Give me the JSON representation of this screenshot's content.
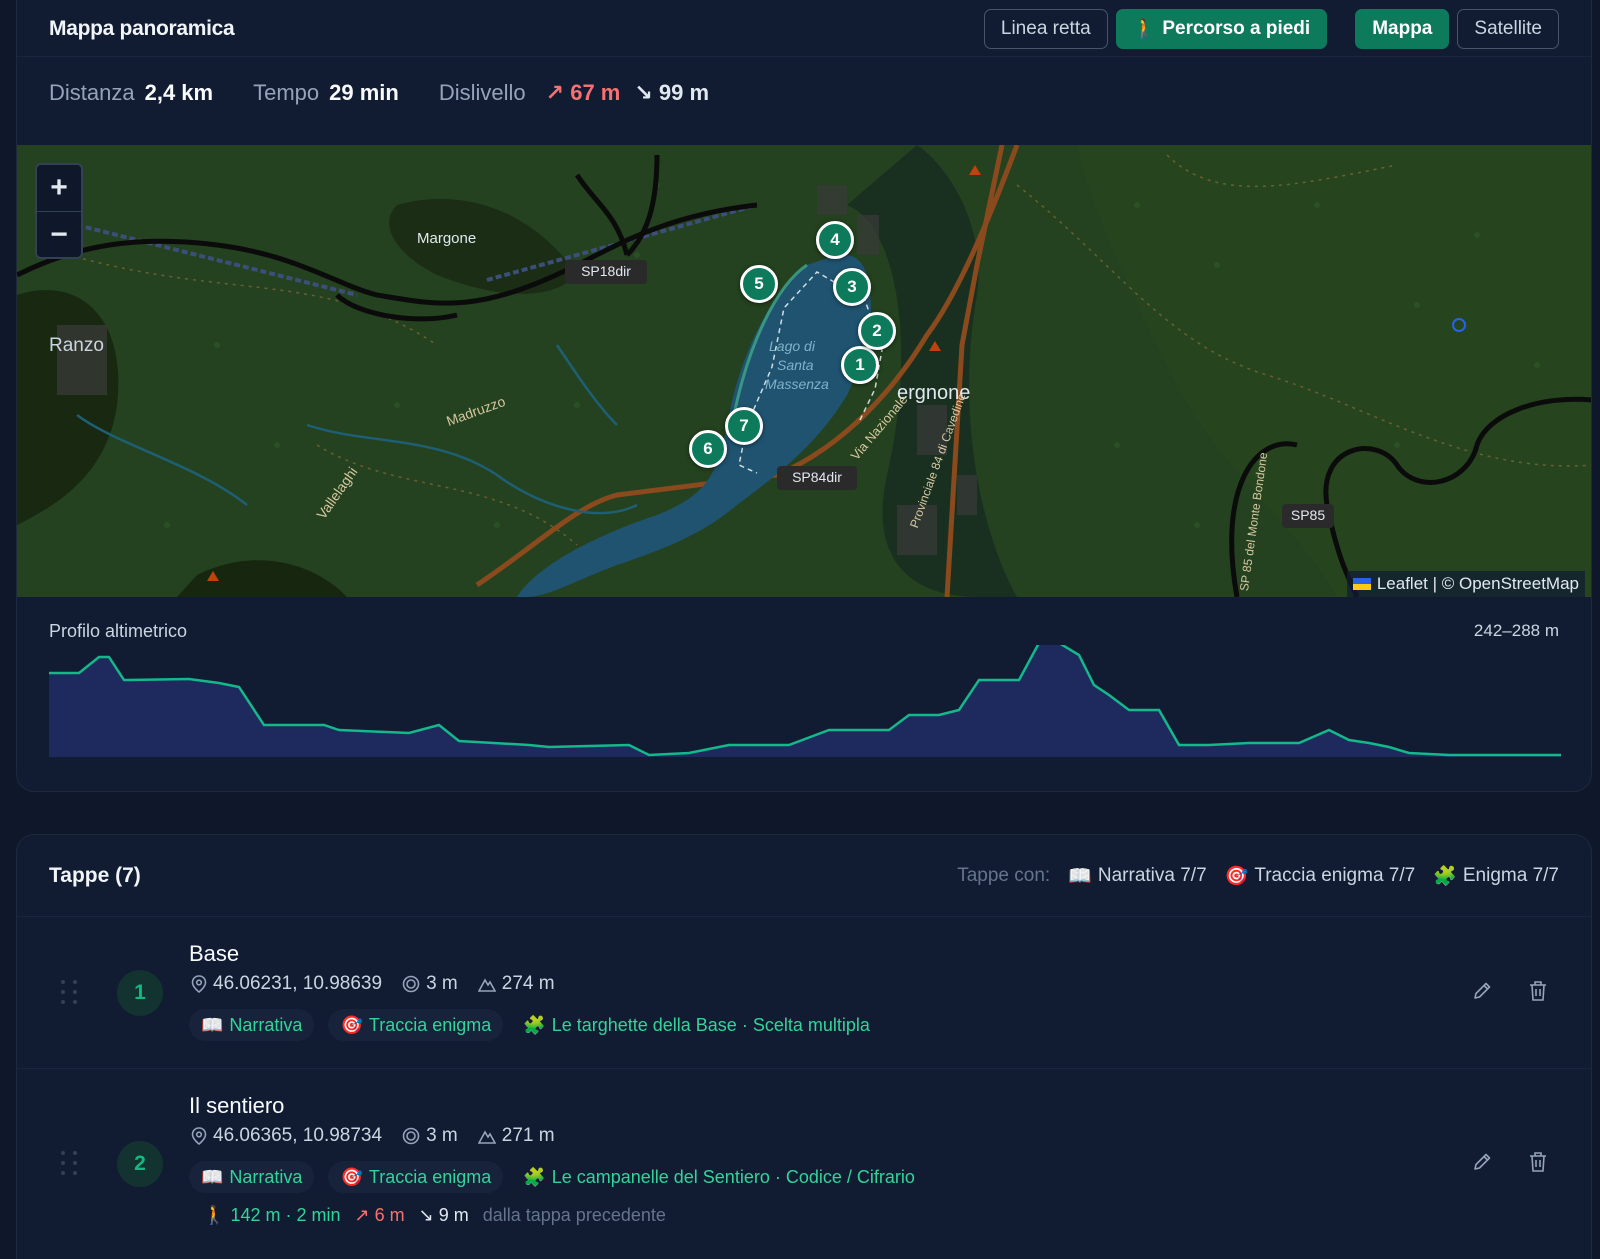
{
  "overview": {
    "title": "Mappa panoramica",
    "buttons": {
      "straight_line": "Linea retta",
      "walking_route": "Percorso a piedi",
      "map": "Mappa",
      "satellite": "Satellite"
    },
    "stats": {
      "distance_label": "Distanza",
      "distance_value": "2,4 km",
      "time_label": "Tempo",
      "time_value": "29 min",
      "elevation_label": "Dislivello",
      "ascent": "67 m",
      "descent": "99 m"
    },
    "map": {
      "zoom_in": "+",
      "zoom_out": "−",
      "attribution": "Leaflet | © OpenStreetMap",
      "place_labels": [
        "Margone",
        "Ranzo",
        "Madruzzo",
        "Vallelaghi",
        "ergnone",
        "Via Nazionale",
        "Lago di",
        "Santa",
        "Massenza",
        "Provinciale 84 di Cavedine",
        "SP 85 del Monte Bondone"
      ],
      "road_labels": [
        "SP18dir",
        "SP84dir",
        "SP85"
      ],
      "markers": [
        "1",
        "2",
        "3",
        "4",
        "5",
        "6",
        "7"
      ]
    },
    "profile": {
      "title": "Profilo altimetrico",
      "range": "242–288 m"
    }
  },
  "stops": {
    "title": "Tappe (7)",
    "summary_label": "Tappe con:",
    "summary": [
      {
        "icon": "book-icon",
        "text": "Narrativa 7/7"
      },
      {
        "icon": "target-icon",
        "text": "Traccia enigma 7/7"
      },
      {
        "icon": "puzzle-icon",
        "text": "Enigma 7/7"
      }
    ],
    "items": [
      {
        "number": "1",
        "name": "Base",
        "coords": "46.06231, 10.98639",
        "radius": "3 m",
        "altitude": "274 m",
        "tag_narrative": "Narrativa",
        "tag_trace": "Traccia enigma",
        "puzzle": "Le targhette della Base · Scelta multipla"
      },
      {
        "number": "2",
        "name": "Il sentiero",
        "coords": "46.06365, 10.98734",
        "radius": "3 m",
        "altitude": "271 m",
        "tag_narrative": "Narrativa",
        "tag_trace": "Traccia enigma",
        "puzzle": "Le campanelle del Sentiero · Codice / Cifrario",
        "leg_walk": "142 m · 2 min",
        "leg_up": "6 m",
        "leg_down": "9 m",
        "leg_note": "dalla tappa precedente"
      }
    ]
  },
  "colors": {
    "accent": "#0e7a5c",
    "accent_text": "#34d399",
    "ascent": "#f87171",
    "background": "#0f172a",
    "card": "#111c33"
  }
}
